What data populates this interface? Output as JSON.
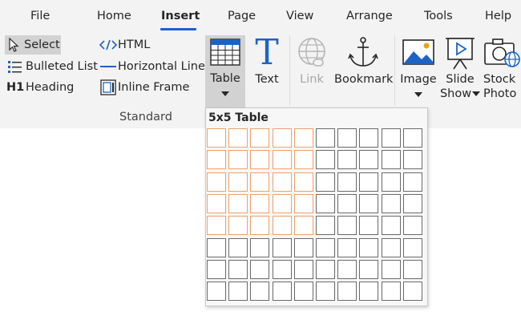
{
  "tabs": [
    "File",
    "Home",
    "Insert",
    "Page",
    "View",
    "Arrange",
    "Tools",
    "Help"
  ],
  "active_tab": "Insert",
  "standard": {
    "select": "Select",
    "bulleted_list": "Bulleted List",
    "heading_prefix": "H1",
    "heading": "Heading",
    "html": "HTML",
    "horizontal_line": "Horizontal Line",
    "inline_frame": "Inline Frame",
    "table": "Table",
    "text": "Text",
    "group_label": "Standard"
  },
  "links": {
    "link": "Link",
    "bookmark": "Bookmark"
  },
  "media": {
    "image": "Image",
    "slide_line1": "Slide",
    "slide_line2": "Show",
    "stock_line1": "Stock",
    "stock_line2": "Photo"
  },
  "table_picker": {
    "title": "5x5 Table",
    "columns": 10,
    "rows": 8,
    "selected_columns": 5,
    "selected_rows": 5
  },
  "colors": {
    "accent": "#1c63c4",
    "highlight_border": "#f0a06a",
    "selected_bg": "#d2d2d2"
  }
}
